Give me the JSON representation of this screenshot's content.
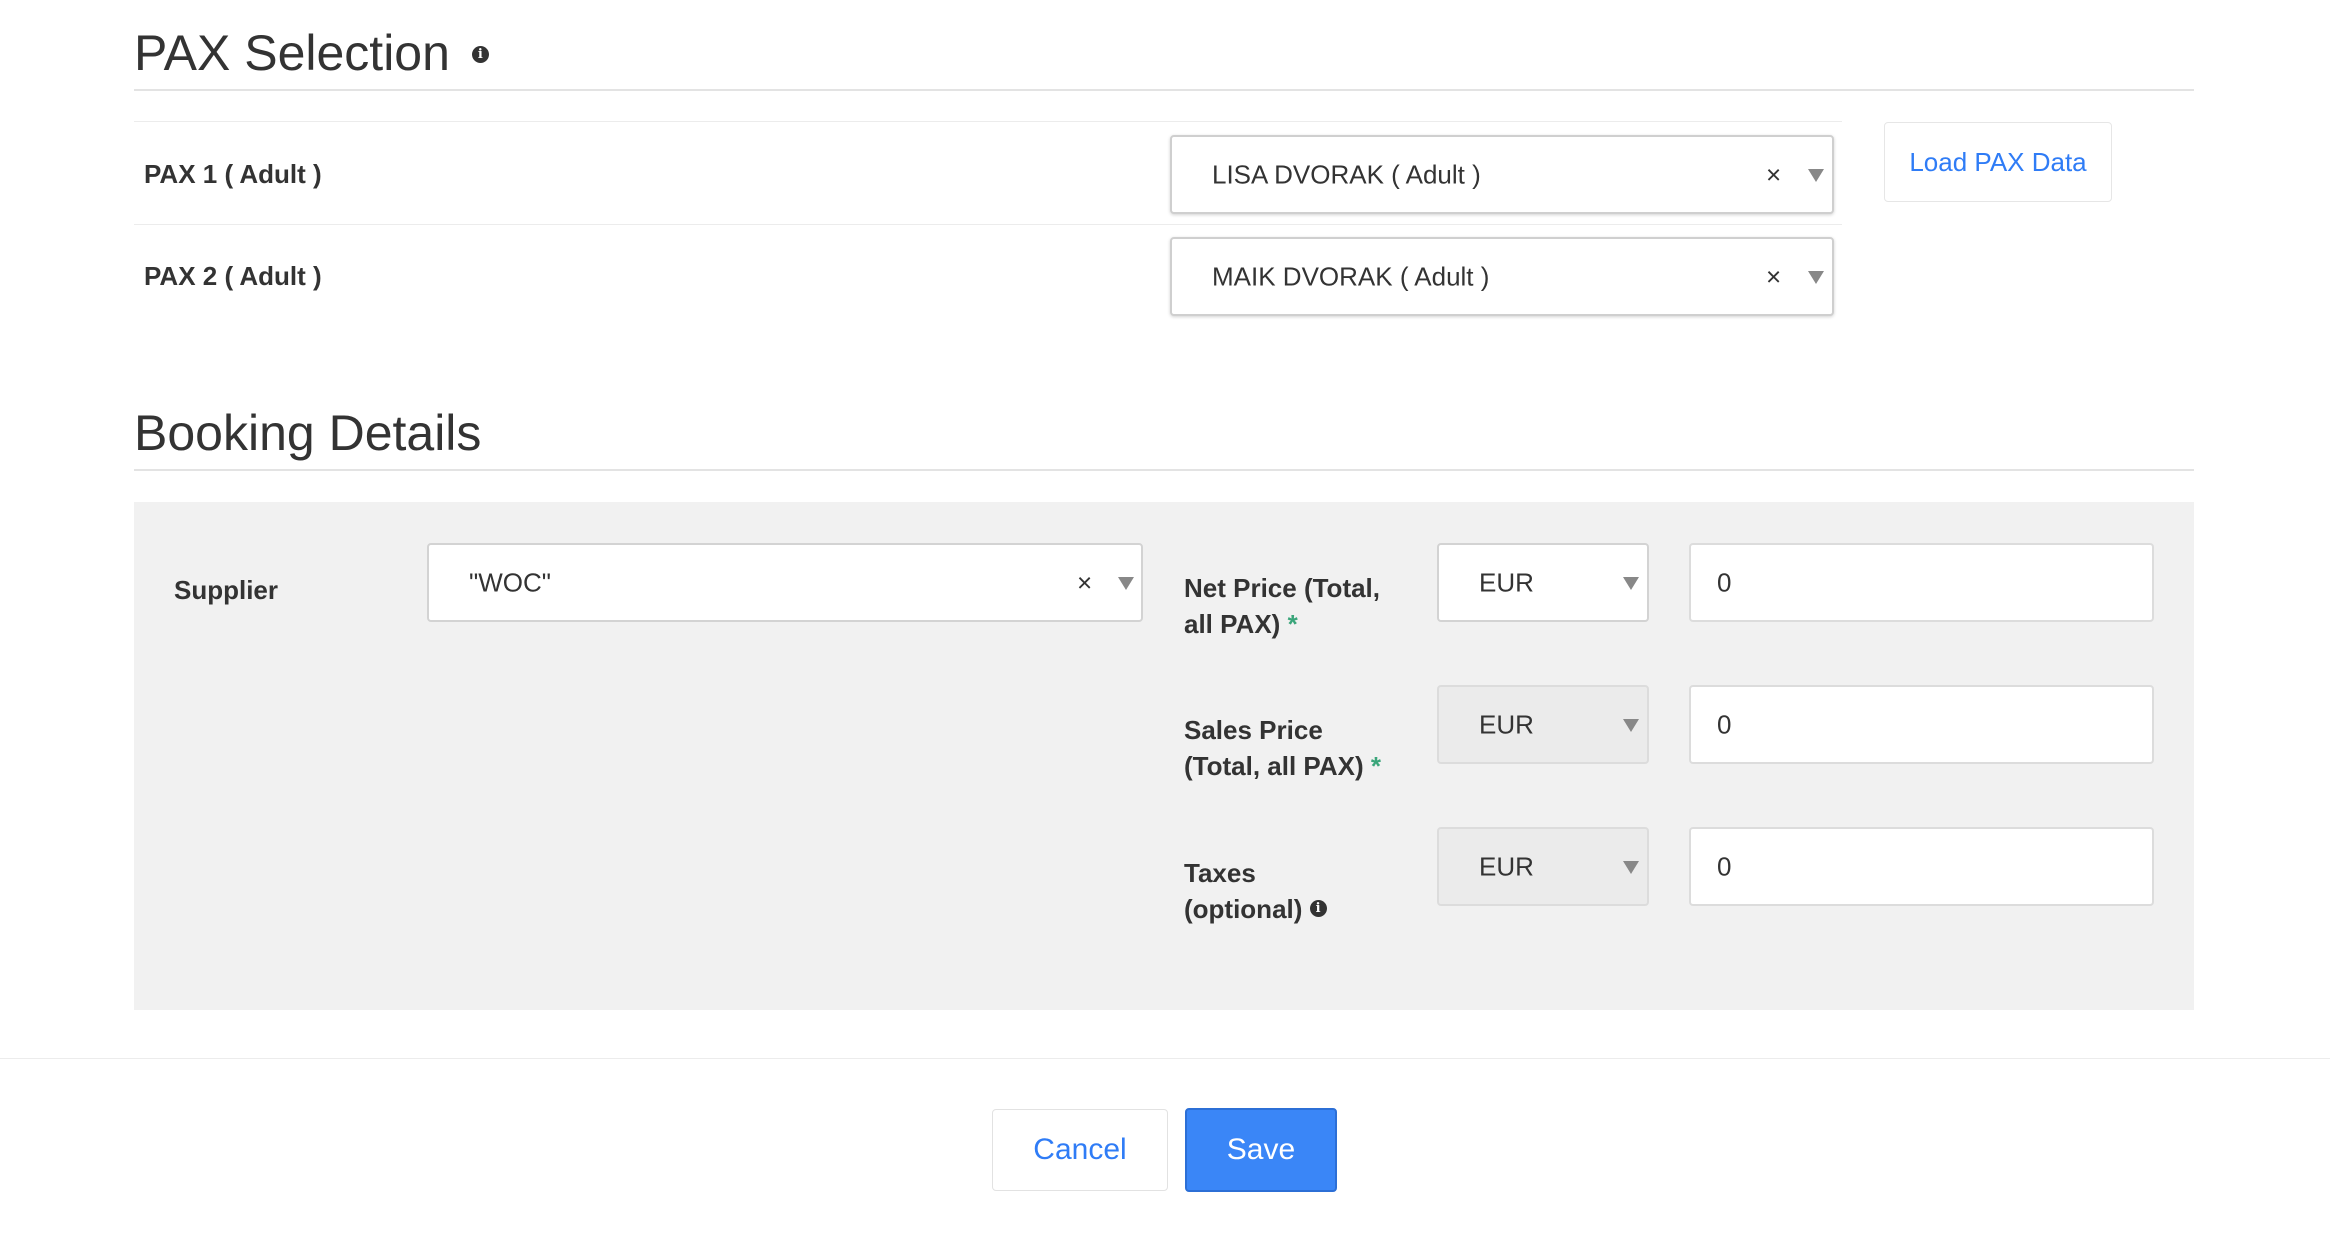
{
  "pax_selection": {
    "title": "PAX Selection",
    "info_icon": "info-icon",
    "rows": [
      {
        "label": "PAX 1 ( Adult )",
        "selected": "LISA DVORAK ( Adult )",
        "clear": "×"
      },
      {
        "label": "PAX 2 ( Adult )",
        "selected": "MAIK DVORAK ( Adult )",
        "clear": "×"
      }
    ],
    "load_button": "Load PAX Data"
  },
  "booking_details": {
    "title": "Booking Details",
    "supplier": {
      "label": "Supplier",
      "value": "\"WOC\"",
      "clear": "×"
    },
    "net_price": {
      "label_line1": "Net Price (Total,",
      "label_line2": "all PAX)",
      "required": "*",
      "currency": "EUR",
      "amount": "0"
    },
    "sales_price": {
      "label_line1": "Sales Price",
      "label_line2": "(Total, all PAX)",
      "required": "*",
      "currency": "EUR",
      "amount": "0"
    },
    "taxes": {
      "label_line1": "Taxes",
      "label_line2": "(optional)",
      "info_icon": "info-icon",
      "currency": "EUR",
      "amount": "0"
    }
  },
  "footer": {
    "cancel_label": "Cancel",
    "save_label": "Save"
  },
  "colors": {
    "primary": "#3a86f7",
    "link": "#2f7cf6",
    "required": "#3aa57a",
    "panel_bg": "#f1f1f1"
  }
}
